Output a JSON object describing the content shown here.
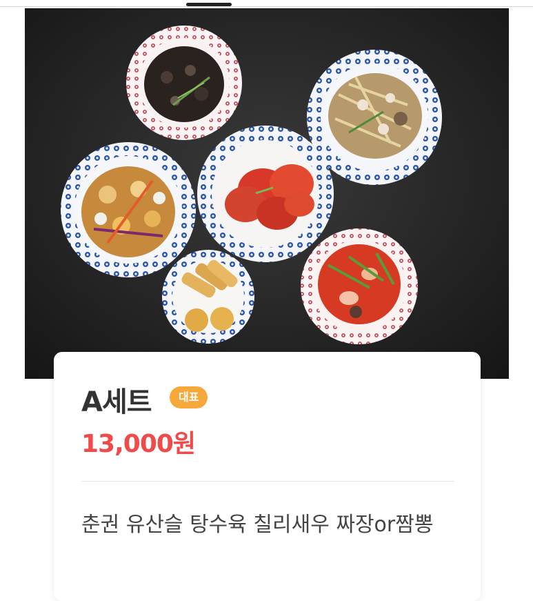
{
  "menu_item": {
    "name": "A세트",
    "badge": "대표",
    "price": "13,000원",
    "description": "춘권 유산슬 탕수육 칠리새우 짜장or짬뽕"
  },
  "colors": {
    "badge_bg": "#f7a83b",
    "price": "#ef4b4b",
    "title": "#333333",
    "photo_bg": "#1c1c1c"
  }
}
